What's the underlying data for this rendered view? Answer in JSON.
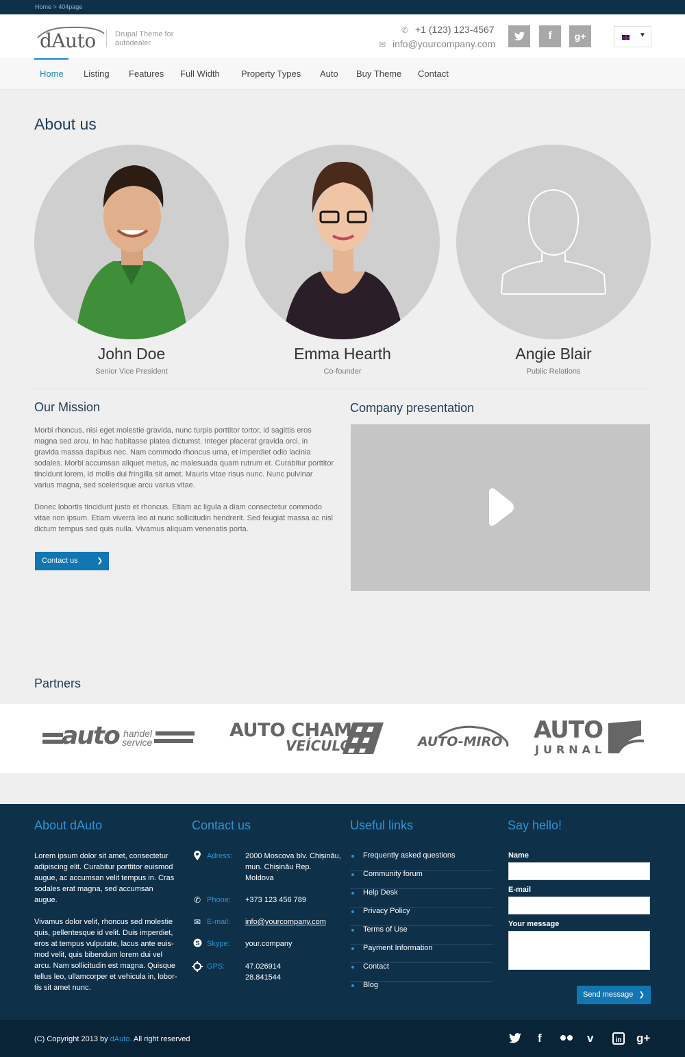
{
  "breadcrumb": "Home > 404page",
  "header": {
    "logo": "dAuto",
    "tagline": "Drupal Theme for autodealer",
    "phone": "+1 (123) 123-4567",
    "email": "info@yourcompany.com",
    "social": [
      "twitter-icon",
      "facebook-icon",
      "google-plus-icon"
    ]
  },
  "nav": {
    "items": [
      "Home",
      "Listing",
      "Features",
      "Full Width",
      "Property Types",
      "Auto",
      "Buy Theme",
      "Contact"
    ],
    "active": "Home"
  },
  "about": {
    "title": "About us",
    "people": [
      {
        "name": "John Doe",
        "role": "Senior Vice President"
      },
      {
        "name": "Emma Hearth",
        "role": "Co-founder"
      },
      {
        "name": "Angie Blair",
        "role": "Public Relations"
      }
    ]
  },
  "mission": {
    "title": "Our Mission",
    "p1": "Morbi rhoncus, nisi eget molestie gravida, nunc turpis porttitor tortor, id sagittis eros magna sed arcu. In hac habitasse platea dictumst. Integer placerat gravida orci, in gravida massa dapibus nec. Nam commodo rhoncus urna, et imperdiet odio lacinia sodales. Morbi accumsan aliquet metus, ac malesuada quam rutrum et. Curabitur porttitor tincidunt lorem, id mollis dui fringilla sit amet. Mauris vitae risus nunc. Nunc pulvinar varius magna, sed scelerisque arcu varius vitae.",
    "p2": "Donec lobortis tincidunt justo et rhoncus. Etiam ac ligula a diam consectetur commodo vitae non ipsum. Etiam viverra leo at nunc sollicitudin hendrerit. Sed feugiat massa ac nisl dictum tempus sed quis nulla. Vivamus aliquam venenatis porta.",
    "button": "Contact us"
  },
  "presentation": {
    "title": "Company presentation"
  },
  "partners": {
    "title": "Partners",
    "logos": [
      {
        "main": "auto",
        "sub1": "handel",
        "sub2": "service"
      },
      {
        "main": "AUTO CHAM",
        "sub": "VEÍCULOS"
      },
      {
        "main": "AUTO-MIRO"
      },
      {
        "main": "AUTO",
        "sub": "JURNAL"
      }
    ]
  },
  "footer": {
    "about_title": "About dAuto",
    "about_p1": "Lorem ipsum dolor sit amet, consectetur adipiscing elit. Curabitur porttitor euismod augue, ac accumsan velit tempus in. Cras sodales erat magna, sed accumsan augue.",
    "about_p2": "Vivamus dolor velit, rhoncus sed molestie quis, pellentesque id velit. Duis imperdiet, eros at tempus vulputate, lacus ante euis-mod velit, quis bibendum lorem dui vel arcu. Nam sollicitudin est magna. Quisque tellus leo, ullamcorper et vehicula in, lobor-tis sit amet nunc.",
    "contact_title": "Contact us",
    "contact": {
      "adress_label": "Adress:",
      "adress": "2000 Moscova blv. Chișinău, mun. Chișinău Rep. Moldova",
      "phone_label": "Phone:",
      "phone": "+373 123 456 789",
      "email_label": "E-mail:",
      "email": "info@yourcompany.com",
      "skype_label": "Skype:",
      "skype": "your.company",
      "gps_label": "GPS:",
      "gps1": "47.026914",
      "gps2": "28.841544"
    },
    "links_title": "Useful links",
    "links": [
      "Frequently asked questions",
      "Community forum",
      "Help Desk",
      "Privacy Policy",
      "Terms of Use",
      "Payment Information",
      "Contact",
      "Blog"
    ],
    "hello_title": "Say hello!",
    "form": {
      "name_label": "Name",
      "email_label": "E-mail",
      "message_label": "Your message",
      "send": "Send message"
    }
  },
  "bottom": {
    "copy_prefix": "(C) Copyright 2013 by ",
    "copy_brand": "dAuto.",
    "copy_suffix": " All right reserved",
    "social": [
      "twitter-icon",
      "facebook-icon",
      "flickr-icon",
      "vimeo-icon",
      "linkedin-icon",
      "google-plus-icon"
    ]
  },
  "colors": {
    "accent": "#1a87c7",
    "footer": "#0e3049",
    "button": "#1276b2"
  }
}
